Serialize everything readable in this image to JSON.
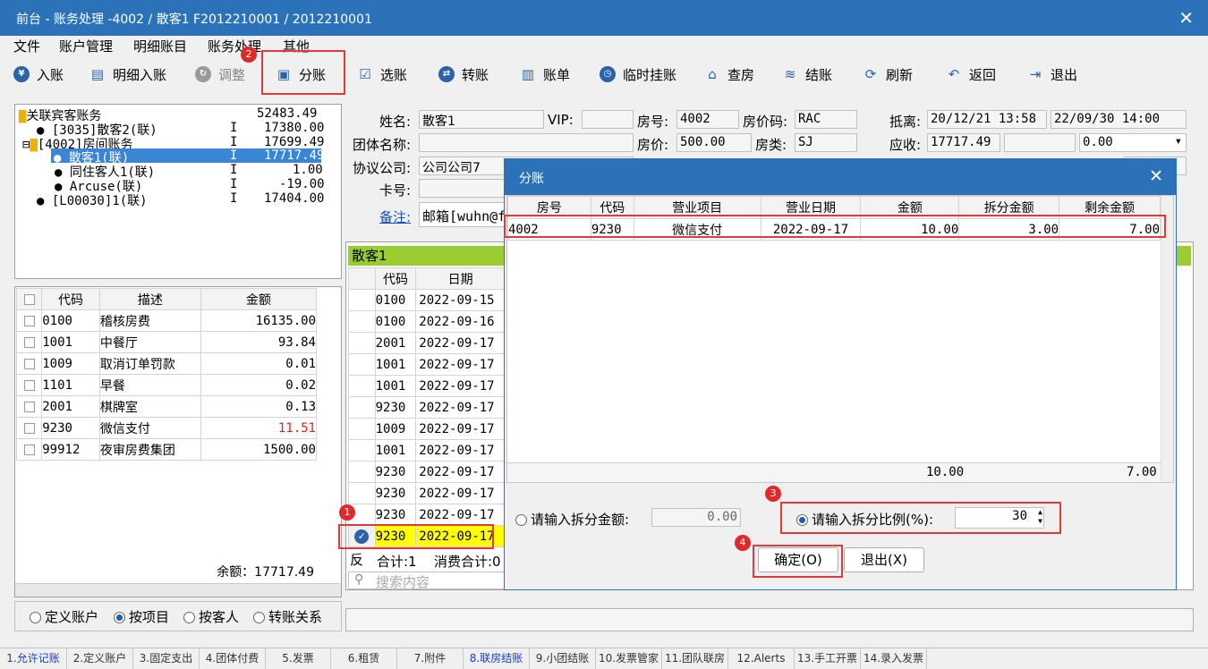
{
  "window": {
    "title": "前台 - 账务处理 -4002 / 散客1 F2012210001 / 2012210001",
    "close": "✕"
  },
  "menu": [
    "文件",
    "账户管理",
    "明细账目",
    "账务处理",
    "其他"
  ],
  "toolbar": [
    {
      "label": "入账",
      "icon": "yen-circle-icon"
    },
    {
      "label": "明细入账",
      "icon": "document-icon"
    },
    {
      "label": "调整",
      "icon": "adjust-icon"
    },
    {
      "label": "分账",
      "icon": "split-icon"
    },
    {
      "label": "选账",
      "icon": "check-square-icon"
    },
    {
      "label": "转账",
      "icon": "transfer-icon"
    },
    {
      "label": "账单",
      "icon": "bill-icon"
    },
    {
      "label": "临时挂账",
      "icon": "clock-icon"
    },
    {
      "label": "查房",
      "icon": "house-search-icon"
    },
    {
      "label": "结账",
      "icon": "coins-icon"
    },
    {
      "label": "刷新",
      "icon": "refresh-icon"
    },
    {
      "label": "返回",
      "icon": "undo-icon"
    },
    {
      "label": "退出",
      "icon": "exit-icon"
    }
  ],
  "badges": [
    "1",
    "2",
    "3",
    "4"
  ],
  "tree": [
    {
      "label": "关联宾客账务",
      "flag": "",
      "amount": "52483.49"
    },
    {
      "label": "[3035]散客2(联)",
      "flag": "I",
      "amount": "17380.00"
    },
    {
      "label": "[4002]房间账务",
      "flag": "I",
      "amount": "17699.49"
    },
    {
      "label": "散客1(联)",
      "flag": "I",
      "amount": "17717.49"
    },
    {
      "label": "同住客人1(联)",
      "flag": "I",
      "amount": "1.00"
    },
    {
      "label": "Arcuse(联)",
      "flag": "I",
      "amount": "-19.00"
    },
    {
      "label": "[L00030]1(联)",
      "flag": "I",
      "amount": "17404.00"
    }
  ],
  "left_table": {
    "headers": [
      "代码",
      "描述",
      "金额"
    ],
    "rows": [
      [
        "0100",
        "稽核房费",
        "16135.00"
      ],
      [
        "1001",
        "中餐厅",
        "93.84"
      ],
      [
        "1009",
        "取消订单罚款",
        "0.01"
      ],
      [
        "1101",
        "早餐",
        "0.02"
      ],
      [
        "2001",
        "棋牌室",
        "0.13"
      ],
      [
        "9230",
        "微信支付",
        "11.51"
      ],
      [
        "99912",
        "夜审房费集团",
        "1500.00"
      ]
    ],
    "balance": "余额：17717.49"
  },
  "left_radios": [
    "定义账户",
    "按项目",
    "按客人",
    "转账关系"
  ],
  "guest": {
    "name_label": "姓名:",
    "name": "散客1",
    "vip_label": "VIP:",
    "vip": "",
    "room_label": "房号:",
    "room": "4002",
    "rate_code_label": "房价码:",
    "rate_code": "RAC",
    "depart_label": "抵离:",
    "arrive": "20/12/21 13:58",
    "depart": "22/09/30 14:00",
    "group_label": "团体名称:",
    "group": "",
    "price_label": "房价:",
    "price": "500.00",
    "type_label": "房类:",
    "type": "SJ",
    "due_label": "应收:",
    "due": "17717.49",
    "due2": "",
    "combo": "0.00",
    "company_label": "协议公司:",
    "company": "公司公司7",
    "card_label": "卡号:",
    "card": "",
    "note_label": "备注:",
    "note": "邮箱[wuhn@f"
  },
  "right_grid": {
    "title": "散客1",
    "headers": [
      "代码",
      "日期"
    ],
    "rows": [
      [
        "0100",
        "2022-09-15"
      ],
      [
        "0100",
        "2022-09-16"
      ],
      [
        "2001",
        "2022-09-17"
      ],
      [
        "1001",
        "2022-09-17"
      ],
      [
        "1001",
        "2022-09-17"
      ],
      [
        "9230",
        "2022-09-17"
      ],
      [
        "1009",
        "2022-09-17"
      ],
      [
        "1001",
        "2022-09-17"
      ],
      [
        "9230",
        "2022-09-17"
      ],
      [
        "9230",
        "2022-09-17"
      ],
      [
        "9230",
        "2022-09-17"
      ],
      [
        "9230",
        "2022-09-17"
      ]
    ],
    "footer_btn": "反",
    "footer_count": "合计:1",
    "footer_consume": "消费合计:0",
    "search_placeholder": "搜索内容"
  },
  "dialog": {
    "title": "分账",
    "headers": [
      "房号",
      "代码",
      "营业项目",
      "营业日期",
      "金额",
      "拆分金额",
      "剩余金额"
    ],
    "row": [
      "4002",
      "9230",
      "微信支付",
      "2022-09-17",
      "10.00",
      "3.00",
      "7.00"
    ],
    "total_amount": "10.00",
    "total_remain": "7.00",
    "amount_label": "请输入拆分金额:",
    "amount_value": "0.00",
    "ratio_label": "请输入拆分比例(%):",
    "ratio_value": "30",
    "ok": "确定(O)",
    "cancel": "退出(X)"
  },
  "tabs": [
    "1.允许记账",
    "2.定义账户",
    "3.固定支出",
    "4.团体付费",
    "5.发票",
    "6.租赁",
    "7.附件",
    "8.联房结账",
    "9.小团结账",
    "10.发票管家",
    "11.团队联房",
    "12.Alerts",
    "13.手工开票",
    "14.录入发票"
  ]
}
